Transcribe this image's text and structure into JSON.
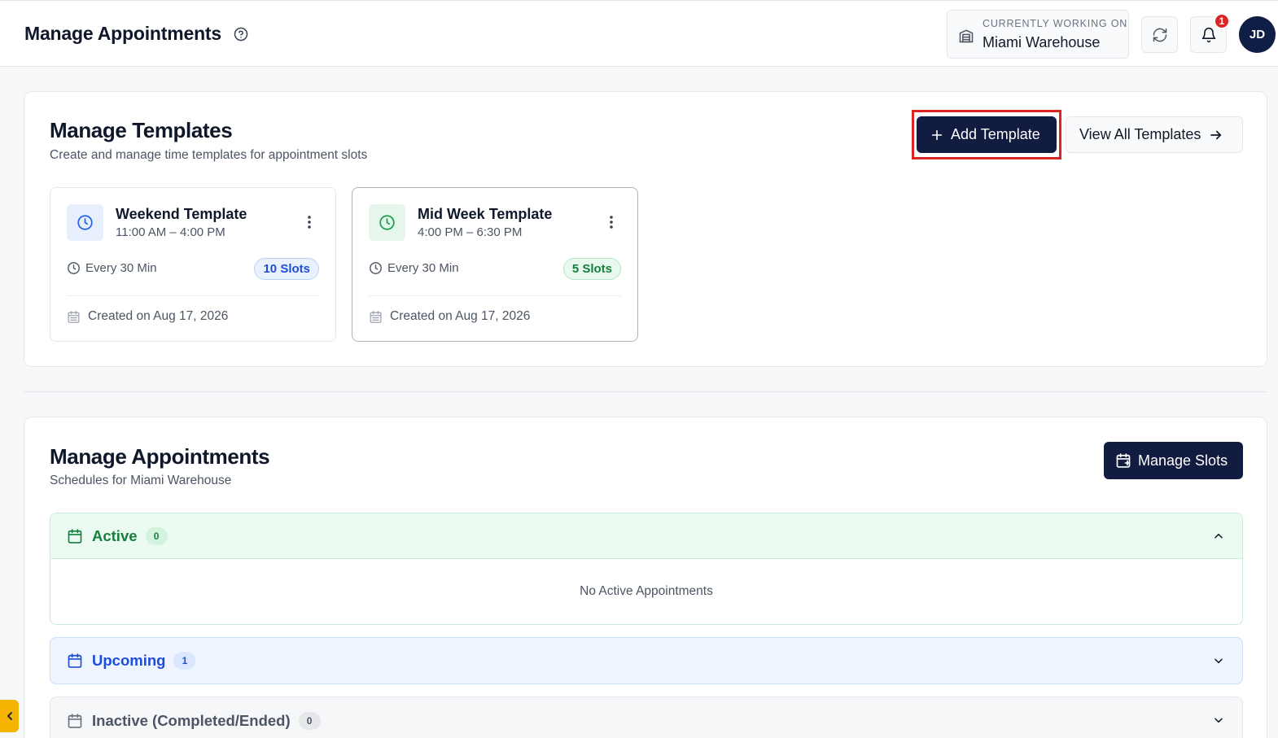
{
  "header": {
    "title": "Manage Appointments",
    "workspace_label": "CURRENTLY WORKING ON",
    "workspace_value": "Miami Warehouse",
    "notification_count": "1",
    "avatar_initials": "JD"
  },
  "templates_section": {
    "title": "Manage Templates",
    "subtitle": "Create and manage time templates for appointment slots",
    "add_button": "Add Template",
    "view_all_button": "View All Templates",
    "templates": [
      {
        "name": "Weekend Template",
        "time_range": "11:00 AM – 4:00 PM",
        "frequency": "Every 30 Min",
        "slots": "10 Slots",
        "created": "Created on Aug 17, 2026",
        "accent": "#2563eb"
      },
      {
        "name": "Mid Week Template",
        "time_range": "4:00 PM – 6:30 PM",
        "frequency": "Every 30 Min",
        "slots": "5 Slots",
        "created": "Created on Aug 17, 2026",
        "accent": "#16a34a"
      }
    ]
  },
  "appointments_section": {
    "title": "Manage Appointments",
    "subtitle": "Schedules for Miami Warehouse",
    "manage_slots_button": "Manage Slots",
    "groups": [
      {
        "label": "Active",
        "count": "0",
        "expanded": true,
        "empty_text": "No Active Appointments"
      },
      {
        "label": "Upcoming",
        "count": "1",
        "expanded": false
      },
      {
        "label": "Inactive (Completed/Ended)",
        "count": "0",
        "expanded": false
      }
    ]
  },
  "colors": {
    "primary": "#111c40",
    "highlight": "#dc2626",
    "active_green": "#15803d",
    "upcoming_blue": "#1d4ed8",
    "side_tab": "#f5b400"
  },
  "icons": {
    "help": "help-circle-icon",
    "workspace": "building-icon",
    "refresh": "refresh-icon",
    "notifications": "bell-icon",
    "template": "clock-icon",
    "frequency": "clock-icon",
    "created": "calendar-icon",
    "menu": "kebab-menu-icon",
    "add": "plus-icon",
    "view_all": "arrow-right-icon",
    "manage_slots": "calendar-plus-icon",
    "collapse": "chevron-up-icon",
    "expand": "chevron-down-icon",
    "side_tab": "chevron-left-icon"
  }
}
